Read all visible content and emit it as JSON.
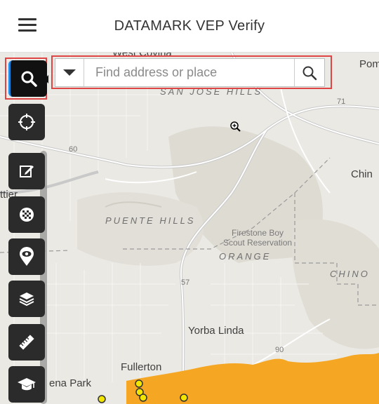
{
  "header": {
    "title": "DATAMARK VEP Verify",
    "menu_icon": "hamburger-menu-icon"
  },
  "search": {
    "placeholder": "Find address or place",
    "value": "",
    "dropdown_icon": "caret-down-icon",
    "button_icon": "search-icon"
  },
  "toolbar": {
    "items": [
      {
        "name": "search-tool",
        "icon": "search-icon",
        "active": true
      },
      {
        "name": "locate-tool",
        "icon": "crosshair-icon"
      },
      {
        "name": "edit-tool",
        "icon": "edit-icon"
      },
      {
        "name": "basemap-tool",
        "icon": "basemap-icon"
      },
      {
        "name": "view-location-tool",
        "icon": "eye-pin-icon"
      },
      {
        "name": "layers-tool",
        "icon": "layers-icon"
      },
      {
        "name": "measure-tool",
        "icon": "ruler-icon"
      },
      {
        "name": "training-tool",
        "icon": "graduation-cap-icon"
      }
    ]
  },
  "map": {
    "labels": {
      "san_jose_hills": "SAN JOSE HILLS",
      "puente_hills": "PUENTE HILLS",
      "firestone_line1": "Firestone Boy",
      "firestone_line2": "Scout Reservation",
      "orange": "ORANGE",
      "chino": "CHINO",
      "chino_city": "Chin",
      "pomona": "Pom",
      "yorba_linda": "Yorba Linda",
      "fullerton": "Fullerton",
      "buena_park": "ena Park",
      "whittier": "ttier",
      "west_covina": "West Covina",
      "route_60": "60",
      "route_57": "57",
      "route_90": "90",
      "route_71": "71"
    },
    "colors": {
      "base": "#ebe9e4",
      "road": "#ffffff",
      "highlight_area": "#f5a623",
      "marker": "#f2e600"
    }
  }
}
